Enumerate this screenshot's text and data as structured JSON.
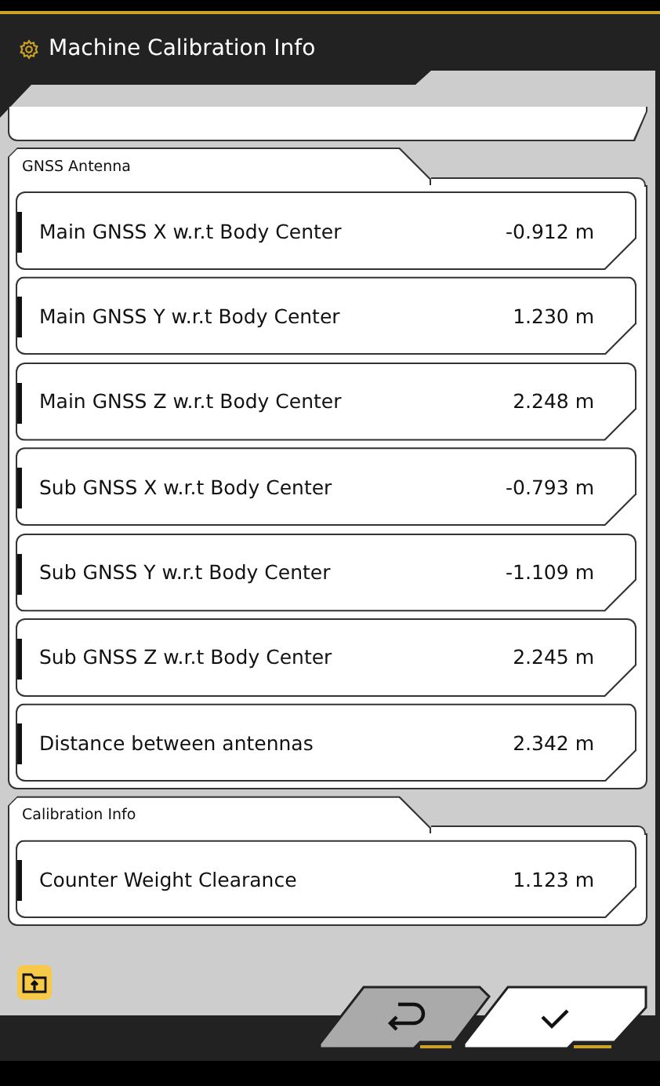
{
  "window": {
    "title": "Machine Calibration Info"
  },
  "sections": [
    {
      "title": "GNSS Antenna",
      "rows": [
        {
          "label": "Main GNSS X w.r.t Body Center",
          "value": "-0.912 m"
        },
        {
          "label": "Main GNSS Y w.r.t Body Center",
          "value": "1.230 m"
        },
        {
          "label": "Main GNSS Z w.r.t Body Center",
          "value": "2.248 m"
        },
        {
          "label": "Sub GNSS X w.r.t Body Center",
          "value": "-0.793 m"
        },
        {
          "label": "Sub GNSS Y w.r.t Body Center",
          "value": "-1.109 m"
        },
        {
          "label": "Sub GNSS Z w.r.t Body Center",
          "value": "2.245 m"
        },
        {
          "label": "Distance between antennas",
          "value": "2.342 m"
        }
      ]
    },
    {
      "title": "Calibration Info",
      "rows": [
        {
          "label": "Counter Weight Clearance",
          "value": "1.123 m"
        }
      ]
    }
  ]
}
